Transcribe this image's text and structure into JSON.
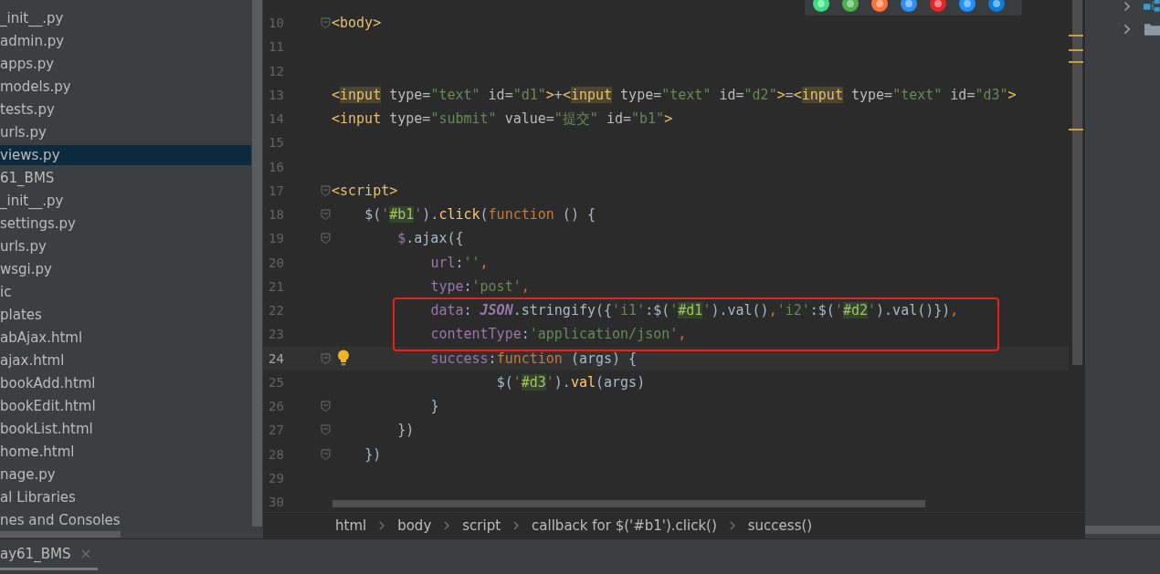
{
  "project_tree": {
    "items": [
      {
        "label": "_init__.py",
        "selected": false
      },
      {
        "label": "admin.py",
        "selected": false
      },
      {
        "label": "apps.py",
        "selected": false
      },
      {
        "label": "models.py",
        "selected": false
      },
      {
        "label": "tests.py",
        "selected": false
      },
      {
        "label": "urls.py",
        "selected": false
      },
      {
        "label": "views.py",
        "selected": true
      },
      {
        "label": "61_BMS",
        "selected": false
      },
      {
        "label": "_init__.py",
        "selected": false
      },
      {
        "label": "settings.py",
        "selected": false
      },
      {
        "label": "urls.py",
        "selected": false
      },
      {
        "label": "wsgi.py",
        "selected": false
      },
      {
        "label": "ic",
        "selected": false
      },
      {
        "label": "plates",
        "selected": false
      },
      {
        "label": "abAjax.html",
        "selected": false
      },
      {
        "label": "ajax.html",
        "selected": false
      },
      {
        "label": "bookAdd.html",
        "selected": false
      },
      {
        "label": "bookEdit.html",
        "selected": false
      },
      {
        "label": "bookList.html",
        "selected": false
      },
      {
        "label": "home.html",
        "selected": false
      },
      {
        "label": "nage.py",
        "selected": false
      },
      {
        "label": "al Libraries",
        "selected": false
      },
      {
        "label": "nes and Consoles",
        "selected": false
      }
    ]
  },
  "editor": {
    "lines": [
      {
        "number": "10",
        "fold": true,
        "current": false,
        "bulb": false,
        "boxed": false,
        "tokens": [
          {
            "text": "<body>",
            "kind": "tag"
          }
        ]
      },
      {
        "number": "11",
        "fold": false,
        "current": false,
        "bulb": false,
        "boxed": false
      },
      {
        "number": "12",
        "fold": false,
        "current": false,
        "bulb": false,
        "boxed": false
      },
      {
        "number": "13",
        "fold": false,
        "current": false,
        "bulb": false,
        "boxed": false,
        "tokens": [
          {
            "text": "<",
            "kind": "tag"
          },
          {
            "text": "input",
            "kind": "taghl"
          },
          {
            "text": " type=",
            "kind": "attr"
          },
          {
            "text": "\"text\"",
            "kind": "str"
          },
          {
            "text": " id=",
            "kind": "attr"
          },
          {
            "text": "\"d1\"",
            "kind": "str"
          },
          {
            "text": ">",
            "kind": "tag"
          },
          {
            "text": "+",
            "kind": "plain"
          },
          {
            "text": "<",
            "kind": "tag"
          },
          {
            "text": "input",
            "kind": "taghl"
          },
          {
            "text": " type=",
            "kind": "attr"
          },
          {
            "text": "\"text\"",
            "kind": "str"
          },
          {
            "text": " id=",
            "kind": "attr"
          },
          {
            "text": "\"d2\"",
            "kind": "str"
          },
          {
            "text": ">",
            "kind": "tag"
          },
          {
            "text": "=",
            "kind": "plain"
          },
          {
            "text": "<",
            "kind": "tag"
          },
          {
            "text": "input",
            "kind": "taghl"
          },
          {
            "text": " type=",
            "kind": "attr"
          },
          {
            "text": "\"text\"",
            "kind": "str"
          },
          {
            "text": " id=",
            "kind": "attr"
          },
          {
            "text": "\"d3\"",
            "kind": "str"
          },
          {
            "text": ">",
            "kind": "tag"
          }
        ]
      },
      {
        "number": "14",
        "fold": false,
        "current": false,
        "bulb": false,
        "boxed": false,
        "tokens": [
          {
            "text": "<input",
            "kind": "tag"
          },
          {
            "text": " type=",
            "kind": "attr"
          },
          {
            "text": "\"submit\"",
            "kind": "str"
          },
          {
            "text": " value=",
            "kind": "attr"
          },
          {
            "text": "\"提交\"",
            "kind": "str"
          },
          {
            "text": " id=",
            "kind": "attr"
          },
          {
            "text": "\"b1\"",
            "kind": "str"
          },
          {
            "text": ">",
            "kind": "tag"
          }
        ]
      },
      {
        "number": "15",
        "fold": false,
        "current": false,
        "bulb": false,
        "boxed": false
      },
      {
        "number": "16",
        "fold": false,
        "current": false,
        "bulb": false,
        "boxed": false
      },
      {
        "number": "17",
        "fold": true,
        "current": false,
        "bulb": false,
        "boxed": false,
        "tokens": [
          {
            "text": "<script>",
            "kind": "tag"
          }
        ]
      },
      {
        "number": "18",
        "fold": true,
        "current": false,
        "bulb": false,
        "boxed": false,
        "tokens": [
          {
            "text": "    $(",
            "kind": "plain"
          },
          {
            "text": "'",
            "kind": "str"
          },
          {
            "text": "#b1",
            "kind": "strhl"
          },
          {
            "text": "'",
            "kind": "str"
          },
          {
            "text": ").",
            "kind": "plain"
          },
          {
            "text": "click",
            "kind": "fn"
          },
          {
            "text": "(",
            "kind": "plain"
          },
          {
            "text": "function",
            "kind": "kw"
          },
          {
            "text": " () {",
            "kind": "plain"
          }
        ]
      },
      {
        "number": "19",
        "fold": true,
        "current": false,
        "bulb": false,
        "boxed": false,
        "tokens": [
          {
            "text": "        $",
            "kind": "prop"
          },
          {
            "text": ".ajax({",
            "kind": "plain"
          }
        ]
      },
      {
        "number": "20",
        "fold": false,
        "current": false,
        "bulb": false,
        "boxed": false,
        "tokens": [
          {
            "text": "            url",
            "kind": "prop"
          },
          {
            "text": ":",
            "kind": "plain"
          },
          {
            "text": "''",
            "kind": "str"
          },
          {
            "text": ",",
            "kind": "kw"
          }
        ]
      },
      {
        "number": "21",
        "fold": false,
        "current": false,
        "bulb": false,
        "boxed": false,
        "tokens": [
          {
            "text": "            type",
            "kind": "prop"
          },
          {
            "text": ":",
            "kind": "plain"
          },
          {
            "text": "'post'",
            "kind": "str"
          },
          {
            "text": ",",
            "kind": "kw"
          }
        ]
      },
      {
        "number": "22",
        "fold": false,
        "current": false,
        "bulb": false,
        "boxed": true,
        "tokens": [
          {
            "text": "            data",
            "kind": "prop"
          },
          {
            "text": ": ",
            "kind": "plain"
          },
          {
            "text": "JSON",
            "kind": "ital"
          },
          {
            "text": ".stringify({",
            "kind": "plain"
          },
          {
            "text": "'i1'",
            "kind": "str"
          },
          {
            "text": ":$(",
            "kind": "plain"
          },
          {
            "text": "'",
            "kind": "str"
          },
          {
            "text": "#d1",
            "kind": "strhl"
          },
          {
            "text": "'",
            "kind": "str"
          },
          {
            "text": ").val()",
            "kind": "plain"
          },
          {
            "text": ",",
            "kind": "kw"
          },
          {
            "text": "'i2'",
            "kind": "str"
          },
          {
            "text": ":$(",
            "kind": "plain"
          },
          {
            "text": "'",
            "kind": "str"
          },
          {
            "text": "#d2",
            "kind": "strhl"
          },
          {
            "text": "'",
            "kind": "str"
          },
          {
            "text": ").val()})",
            "kind": "plain"
          },
          {
            "text": ",",
            "kind": "kw"
          }
        ]
      },
      {
        "number": "23",
        "fold": false,
        "current": false,
        "bulb": false,
        "boxed": true,
        "tokens": [
          {
            "text": "            contentType",
            "kind": "prop"
          },
          {
            "text": ":",
            "kind": "plain"
          },
          {
            "text": "'application/json'",
            "kind": "str"
          },
          {
            "text": ",",
            "kind": "kw"
          }
        ]
      },
      {
        "number": "24",
        "fold": true,
        "current": true,
        "bulb": true,
        "boxed": false,
        "tokens": [
          {
            "text": "            success",
            "kind": "prop"
          },
          {
            "text": ":",
            "kind": "plain"
          },
          {
            "text": "function",
            "kind": "kw"
          },
          {
            "text": " (args) {",
            "kind": "plain"
          }
        ]
      },
      {
        "number": "25",
        "fold": false,
        "current": false,
        "bulb": false,
        "boxed": false,
        "tokens": [
          {
            "text": "                    $(",
            "kind": "plain"
          },
          {
            "text": "'",
            "kind": "str"
          },
          {
            "text": "#d3",
            "kind": "strhl"
          },
          {
            "text": "'",
            "kind": "str"
          },
          {
            "text": ").",
            "kind": "plain"
          },
          {
            "text": "val",
            "kind": "fn"
          },
          {
            "text": "(args)",
            "kind": "plain"
          }
        ]
      },
      {
        "number": "26",
        "fold": true,
        "current": false,
        "bulb": false,
        "boxed": false,
        "tokens": [
          {
            "text": "            }",
            "kind": "plain"
          }
        ]
      },
      {
        "number": "27",
        "fold": true,
        "current": false,
        "bulb": false,
        "boxed": false,
        "tokens": [
          {
            "text": "        })",
            "kind": "plain"
          }
        ]
      },
      {
        "number": "28",
        "fold": true,
        "current": false,
        "bulb": false,
        "boxed": false,
        "tokens": [
          {
            "text": "    })",
            "kind": "plain"
          }
        ]
      },
      {
        "number": "29",
        "fold": false,
        "current": false,
        "bulb": false,
        "boxed": false
      },
      {
        "number": "30",
        "fold": false,
        "current": false,
        "bulb": false,
        "boxed": false
      }
    ],
    "breadcrumbs": [
      "html",
      "body",
      "script",
      "callback for $('#b1').click()",
      "success()"
    ]
  },
  "bottom_panel": {
    "tabs": [
      {
        "label": "ay61_BMS",
        "selected": true
      }
    ]
  }
}
